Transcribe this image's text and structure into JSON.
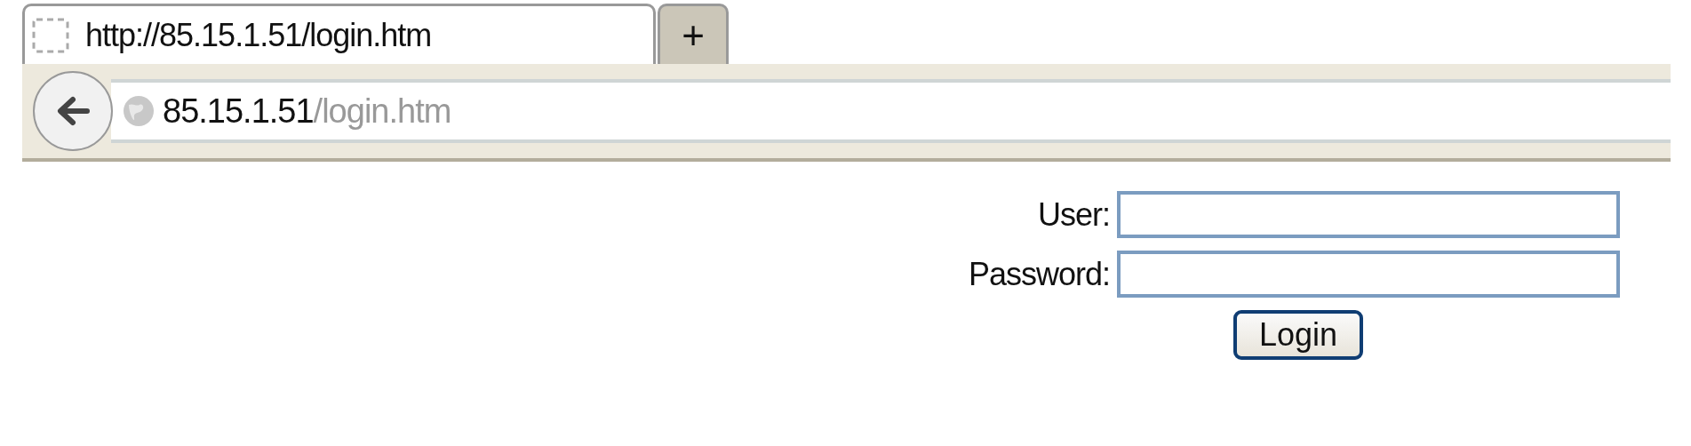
{
  "tabs": [
    {
      "title": "http://85.15.1.51/login.htm",
      "selected": true
    }
  ],
  "new_tab_button": {
    "label": "+"
  },
  "address_bar": {
    "host": "85.15.1.51",
    "path": "/login.htm"
  },
  "form": {
    "fields": [
      {
        "label": "User:"
      },
      {
        "label": "Password:"
      }
    ],
    "submit": "Login"
  }
}
